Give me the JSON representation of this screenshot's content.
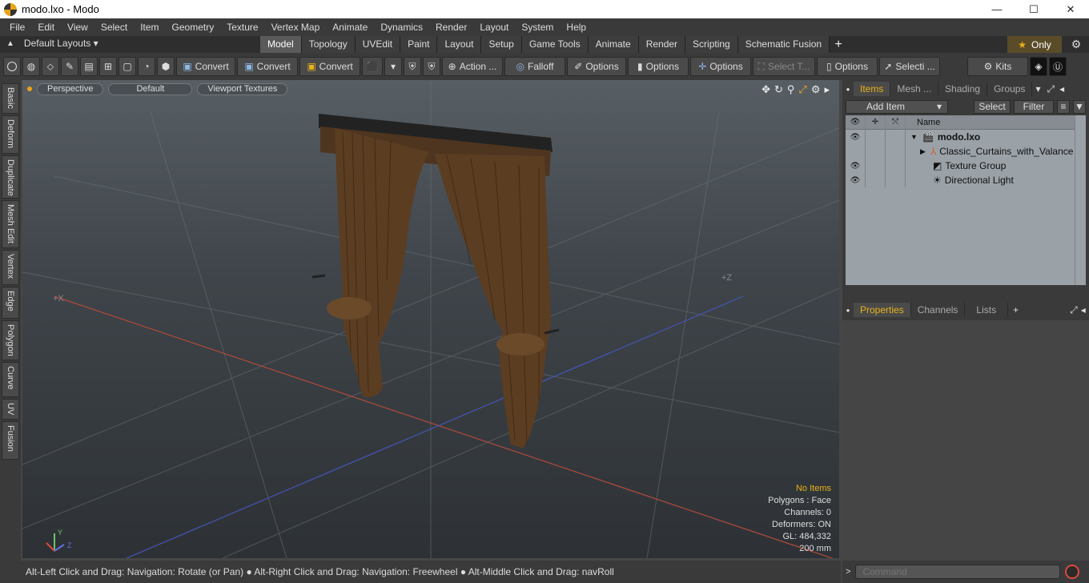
{
  "window": {
    "title": "modo.lxo - Modo",
    "minimize": "—",
    "maximize": "☐",
    "close": "✕"
  },
  "menu": [
    "File",
    "Edit",
    "View",
    "Select",
    "Item",
    "Geometry",
    "Texture",
    "Vertex Map",
    "Animate",
    "Dynamics",
    "Render",
    "Layout",
    "System",
    "Help"
  ],
  "layout_selector": "Default Layouts",
  "tabs": [
    "Model",
    "Topology",
    "UVEdit",
    "Paint",
    "Layout",
    "Setup",
    "Game Tools",
    "Animate",
    "Render",
    "Scripting",
    "Schematic Fusion"
  ],
  "active_tab": "Model",
  "only_label": "Only",
  "toolbar": {
    "convert1": "Convert",
    "convert2": "Convert",
    "convert3": "Convert",
    "action": "Action ...",
    "falloff": "Falloff",
    "options1": "Options",
    "options2": "Options",
    "options3": "Options",
    "select_t": "Select T...",
    "options4": "Options",
    "selecti": "Selecti ...",
    "kits": "Kits"
  },
  "left_tabs": [
    "Basic",
    "Deform",
    "Duplicate",
    "Mesh Edit",
    "Vertex",
    "Edge",
    "Polygon",
    "Curve",
    "UV",
    "Fusion"
  ],
  "viewport": {
    "perspective": "Perspective",
    "default": "Default",
    "textures": "Viewport Textures",
    "axis_x": "+X",
    "axis_z": "+Z",
    "info": {
      "no_items": "No Items",
      "polygons": "Polygons : Face",
      "channels": "Channels: 0",
      "deformers": "Deformers: ON",
      "gl": "GL: 484,332",
      "scale": "200 mm"
    }
  },
  "status": "Alt-Left Click and Drag: Navigation: Rotate (or Pan) ● Alt-Right Click and Drag: Navigation: Freewheel ● Alt-Middle Click and Drag: navRoll",
  "panel": {
    "tabs": [
      "Items",
      "Mesh ...",
      "Shading",
      "Groups"
    ],
    "add_item": "Add Item",
    "select": "Select",
    "filter": "Filter",
    "name_header": "Name",
    "items": [
      {
        "label": "modo.lxo",
        "eye": true
      },
      {
        "label": "Classic_Curtains_with_Valance",
        "eye": false
      },
      {
        "label": "Texture Group",
        "eye": true
      },
      {
        "label": "Directional Light",
        "eye": true
      }
    ],
    "prop_tabs": [
      "Properties",
      "Channels",
      "Lists"
    ],
    "command_placeholder": "Command"
  },
  "colors": {
    "accent": "#e8b21a",
    "curtain": "#5b3d22"
  }
}
